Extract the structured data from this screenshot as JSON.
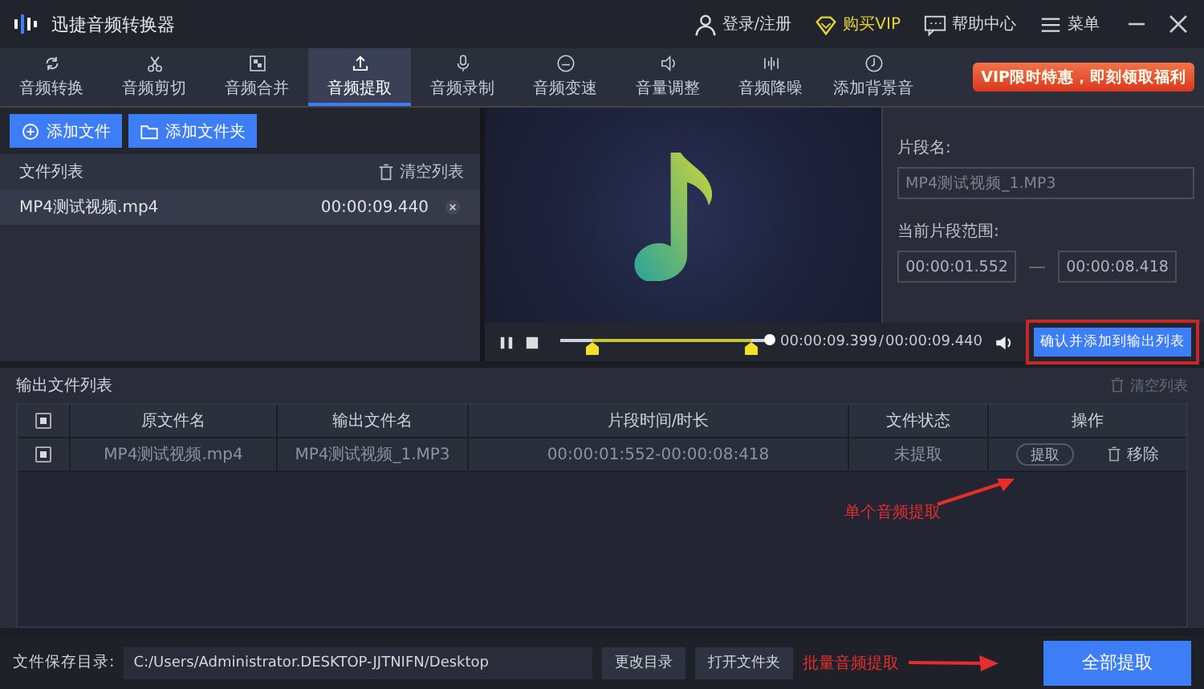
{
  "window": {
    "title": "迅捷音频转换器"
  },
  "title_actions": [
    {
      "label": "登录/注册",
      "kind": "user"
    },
    {
      "label": "购买VIP",
      "kind": "vip"
    },
    {
      "label": "帮助中心",
      "kind": "help"
    },
    {
      "label": "菜单",
      "kind": "menu"
    }
  ],
  "tabs": [
    {
      "label": "音频转换",
      "selected": false
    },
    {
      "label": "音频剪切",
      "selected": false
    },
    {
      "label": "音频合并",
      "selected": false
    },
    {
      "label": "音频提取",
      "selected": true
    },
    {
      "label": "音频录制",
      "selected": false
    },
    {
      "label": "音频变速",
      "selected": false
    },
    {
      "label": "音量调整",
      "selected": false
    },
    {
      "label": "音频降噪",
      "selected": false
    },
    {
      "label": "添加背景音",
      "selected": false
    }
  ],
  "promo": "VIP限时特惠，即刻领取福利",
  "file_panel": {
    "buttons": [
      "添加文件",
      "添加文件夹"
    ],
    "title": "文件列表",
    "clear": "清空列表",
    "files": [
      {
        "name": "MP4测试视频.mp4",
        "duration": "00:00:09.440"
      }
    ]
  },
  "player": {
    "current": "00:00:09.399",
    "separator": "/",
    "total": "00:00:09.440",
    "position": {
      "level": 0.995
    },
    "handles": [
      {
        "level": 0.15
      },
      {
        "level": 0.9
      }
    ]
  },
  "segment": {
    "name_label": "片段名:",
    "name_placeholder": "MP4测试视频_1.MP3",
    "range_label": "当前片段范围:",
    "start": "00:00:01.552",
    "end": "00:00:08.418"
  },
  "confirm_button": {
    "label": "确认并添加到输出列表",
    "highlighted": true
  },
  "output": {
    "title": "输出文件列表",
    "clear": "清空列表",
    "all_checked": true,
    "columns": [
      "原文件名",
      "输出文件名",
      "片段时间/时长",
      "文件状态",
      "操作"
    ],
    "rows": [
      {
        "checked": true,
        "source": "MP4测试视频.mp4",
        "output": "MP4测试视频_1.MP3",
        "time": "00:00:01:552-00:00:08:418",
        "status": "未提取",
        "extract": "提取",
        "remove": "移除"
      }
    ]
  },
  "annotations": [
    "单个音频提取",
    "批量音频提取"
  ],
  "footer": {
    "label": "文件保存目录:",
    "path": "C:/Users/Administrator.DESKTOP-JJTNIFN/Desktop",
    "change": "更改目录",
    "open": "打开文件夹",
    "extract_all": "全部提取"
  }
}
